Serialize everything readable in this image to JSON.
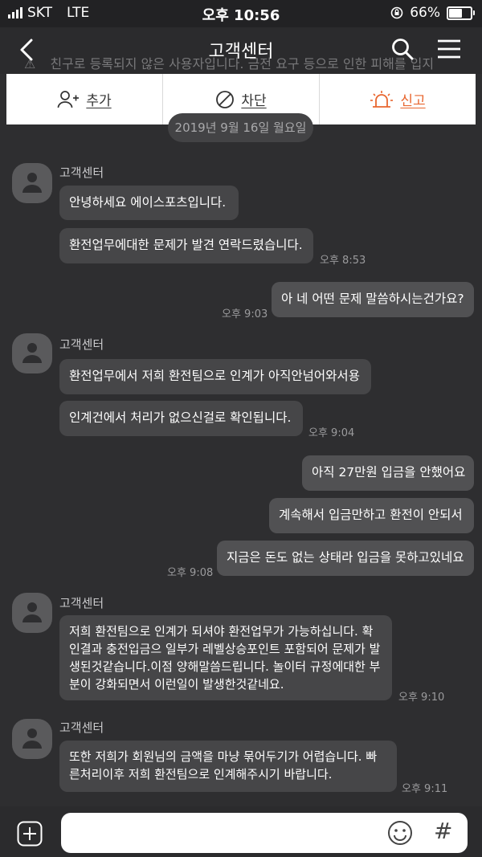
{
  "status": {
    "carrier": "SKT",
    "network": "LTE",
    "time": "오후 10:56",
    "battery": "66%",
    "battery_level": 0.66
  },
  "header": {
    "title": "고객센터",
    "notice_text": "친구로 등록되지 않은 사용자입니다. 금전 요구 등으로 인한 피해를 입지"
  },
  "actions": {
    "add": "추가",
    "block": "차단",
    "report": "신고",
    "report_color": "#e8662f"
  },
  "date_divider": "2019년 9월 16일 월요일",
  "messages": {
    "g1": {
      "sender": "고객센터",
      "b1": "안녕하세요 에이스포츠입니다.",
      "b2": "환전업무에대한 문제가 발견 연락드렸습니다.",
      "time": "오후 8:53"
    },
    "m1": {
      "text": "아 네 어떤 문제 말씀하시는건가요?",
      "time": "오후 9:03"
    },
    "g2": {
      "sender": "고객센터",
      "b1": "환전업무에서 저희 환전팀으로 인계가 아직안넘어와서용",
      "b2": "인계건에서 처리가 없으신걸로 확인됩니다.",
      "time": "오후 9:04"
    },
    "m2": {
      "b1": "아직 27만원 입금을 안했어요",
      "b2": "계속해서 입금만하고 환전이 안되서",
      "b3": "지금은 돈도 없는 상태라 입금을 못하고있네요",
      "time": "오후 9:08"
    },
    "g3": {
      "sender": "고객센터",
      "text": "저희 환전팀으로 인계가 되셔야 환전업무가 가능하십니다. 확인결과 충전입금으 일부가 레벨상승포인트 포함되어 문제가 발생된것같습니다.이점 양해말씀드립니다. 놀이터 규정에대한 부분이 강화되면서 이런일이 발생한것같네요.",
      "time": "오후 9:10"
    },
    "g4": {
      "sender": "고객센터",
      "text": "또한 저희가 회원님의 금액을 마냥 묶어두기가 어렵습니다. 빠른처리이후 저희 환전팀으로 인계해주시기 바랍니다.",
      "time": "오후 9:11"
    }
  },
  "input": {
    "placeholder": ""
  }
}
